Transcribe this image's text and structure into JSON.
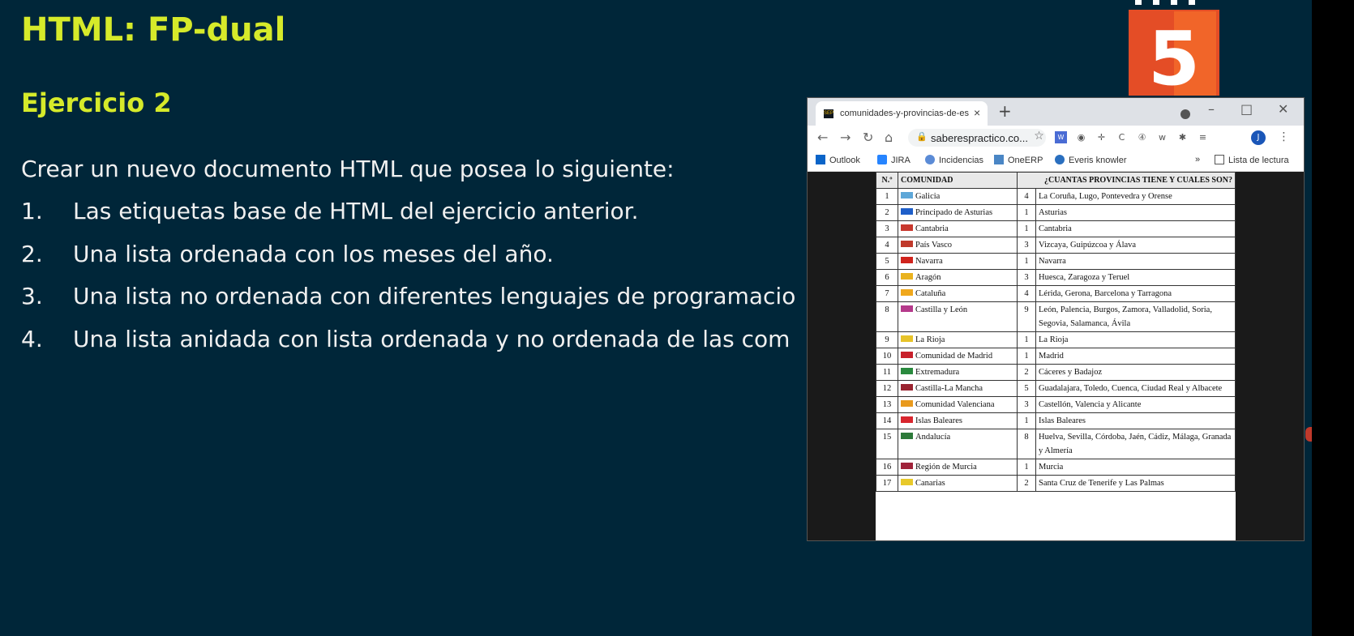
{
  "slide": {
    "title": "HTML: FP-dual",
    "subtitle": "Ejercicio 2",
    "intro": "Crear un nuevo documento HTML que posea lo siguiente:",
    "tasks": [
      {
        "num": "1.",
        "text": "Las etiquetas base de HTML del ejercicio anterior."
      },
      {
        "num": "2.",
        "text": "Una lista ordenada con los meses del año."
      },
      {
        "num": "3.",
        "text": "Una lista no ordenada con diferentes lenguajes de programacio"
      },
      {
        "num": "4.",
        "text": "Una lista anidada con lista ordenada y no ordenada de las com"
      }
    ],
    "logo_text": "5",
    "colors": {
      "background": "#002639",
      "heading": "#d6ea2a",
      "text": "#f0f0f0",
      "html5_orange": "#e44d26"
    }
  },
  "browser": {
    "tab_title": "comunidades-y-provincias-de-es",
    "tab_favicon_text": "SEP",
    "tab_close": "×",
    "new_tab": "+",
    "url": "saberespractico.co...",
    "avatar_letter": "J",
    "bookmarks": [
      "Outlook",
      "JIRA",
      "Incidencias",
      "OneERP",
      "Everis knowler"
    ],
    "bookmarks_more": "»",
    "reading_list": "Lista de lectura"
  },
  "table": {
    "headers": [
      "N.º",
      "COMUNIDAD",
      "¿CUANTAS PROVINCIAS TIENE Y CUALES SON?"
    ],
    "rows": [
      {
        "n": "1",
        "community": "Galicia",
        "count": "4",
        "provinces": "La Coruña, Lugo, Pontevedra y Orense",
        "flag": "#5ea7d8"
      },
      {
        "n": "2",
        "community": "Principado de Asturias",
        "count": "1",
        "provinces": "Asturias",
        "flag": "#1f5fc9"
      },
      {
        "n": "3",
        "community": "Cantabria",
        "count": "1",
        "provinces": "Cantabria",
        "flag": "#c8382e"
      },
      {
        "n": "4",
        "community": "País Vasco",
        "count": "3",
        "provinces": "Vizcaya, Guipúzcoa y Álava",
        "flag": "#c0392b"
      },
      {
        "n": "5",
        "community": "Navarra",
        "count": "1",
        "provinces": "Navarra",
        "flag": "#d0241d"
      },
      {
        "n": "6",
        "community": "Aragón",
        "count": "3",
        "provinces": "Huesca, Zaragoza y Teruel",
        "flag": "#e9b21f"
      },
      {
        "n": "7",
        "community": "Cataluña",
        "count": "4",
        "provinces": "Lérida, Gerona, Barcelona y Tarragona",
        "flag": "#f0a81c"
      },
      {
        "n": "8",
        "community": "Castilla y León",
        "count": "9",
        "provinces": "León, Palencia, Burgos, Zamora, Valladolid, Soria, Segovia, Salamanca, Ávila",
        "flag": "#b53a8b"
      },
      {
        "n": "9",
        "community": "La Rioja",
        "count": "1",
        "provinces": "La Rioja",
        "flag": "#e7c329"
      },
      {
        "n": "10",
        "community": "Comunidad de Madrid",
        "count": "1",
        "provinces": "Madrid",
        "flag": "#c8202b"
      },
      {
        "n": "11",
        "community": "Extremadura",
        "count": "2",
        "provinces": "Cáceres y Badajoz",
        "flag": "#2a8a3e"
      },
      {
        "n": "12",
        "community": "Castilla-La Mancha",
        "count": "5",
        "provinces": "Guadalajara, Toledo, Cuenca, Ciudad Real y Albacete",
        "flag": "#9a2430"
      },
      {
        "n": "13",
        "community": "Comunidad Valenciana",
        "count": "3",
        "provinces": "Castellón, Valencia y Alicante",
        "flag": "#e99a1d"
      },
      {
        "n": "14",
        "community": "Islas Baleares",
        "count": "1",
        "provinces": "Islas Baleares",
        "flag": "#d8262e"
      },
      {
        "n": "15",
        "community": "Andalucía",
        "count": "8",
        "provinces": "Huelva, Sevilla, Córdoba, Jaén, Cádiz, Málaga, Granada y Almería",
        "flag": "#2d7a3a"
      },
      {
        "n": "16",
        "community": "Región de Murcia",
        "count": "1",
        "provinces": "Murcia",
        "flag": "#a0233a"
      },
      {
        "n": "17",
        "community": "Canarias",
        "count": "2",
        "provinces": "Santa Cruz de Tenerife y Las Palmas",
        "flag": "#e8c92a"
      }
    ]
  }
}
